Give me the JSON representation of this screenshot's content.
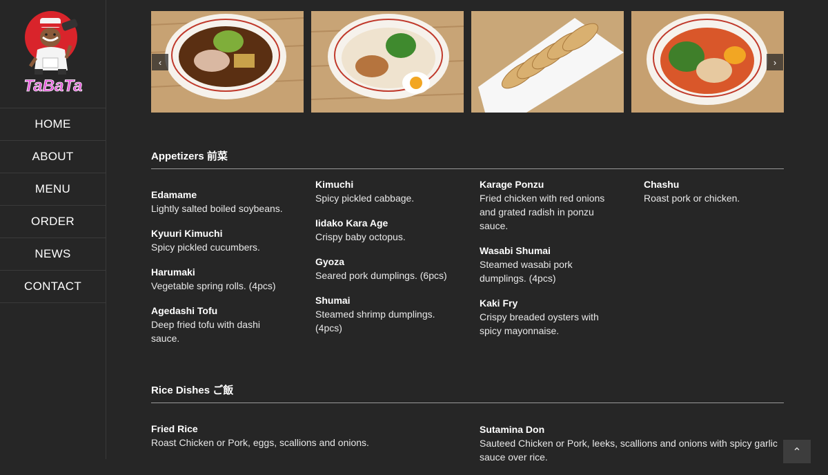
{
  "brand": {
    "logo_text": "TaBaTa",
    "accent": "#d9242b",
    "logo_text_color": "#e25bd8"
  },
  "nav": {
    "items": [
      "HOME",
      "ABOUT",
      "MENU",
      "ORDER",
      "NEWS",
      "CONTACT"
    ]
  },
  "gallery": {
    "prev_icon": "chevron-left-icon",
    "next_icon": "chevron-right-icon",
    "photos": [
      "shoyu-ramen-bowl",
      "chicken-ramen-bowl",
      "gyoza-plate",
      "spicy-ramen-bowl"
    ]
  },
  "appetizers": {
    "title": "Appetizers 前菜",
    "col1": [
      {
        "name": "Edamame",
        "desc": "Lightly salted boiled soybeans."
      },
      {
        "name": "Kyuuri Kimuchi",
        "desc": "Spicy pickled cucumbers."
      },
      {
        "name": "Harumaki",
        "desc": "Vegetable spring rolls. (4pcs)"
      },
      {
        "name": "Agedashi Tofu",
        "desc": "Deep fried tofu with dashi sauce."
      }
    ],
    "col2": [
      {
        "name": "Kimuchi",
        "desc": "Spicy pickled cabbage."
      },
      {
        "name": "Iidako Kara Age",
        "desc": "Crispy baby octopus."
      },
      {
        "name": "Gyoza",
        "desc": "Seared pork dumplings. (6pcs)"
      },
      {
        "name": "Shumai",
        "desc": "Steamed shrimp dumplings. (4pcs)"
      }
    ],
    "col3": [
      {
        "name": "Karage Ponzu",
        "desc": "Fried chicken with red onions and grated radish in ponzu sauce."
      },
      {
        "name": "Wasabi Shumai",
        "desc": "Steamed wasabi pork dumplings. (4pcs)"
      },
      {
        "name": "Kaki Fry",
        "desc": "Crispy breaded oysters with spicy mayonnaise."
      }
    ],
    "col4": [
      {
        "name": "Chashu",
        "desc": "Roast pork or chicken."
      }
    ]
  },
  "rice": {
    "title": "Rice Dishes ご飯",
    "left": [
      {
        "name": "Fried Rice",
        "desc": "Roast Chicken or Pork, eggs, scallions and onions."
      }
    ],
    "right": [
      {
        "name": "Sutamina Don",
        "desc": "Sauteed Chicken or Pork, leeks, scallions and onions with spicy garlic sauce over rice."
      }
    ]
  },
  "back_to_top": {
    "icon": "chevron-up-icon",
    "glyph": "⌃"
  }
}
